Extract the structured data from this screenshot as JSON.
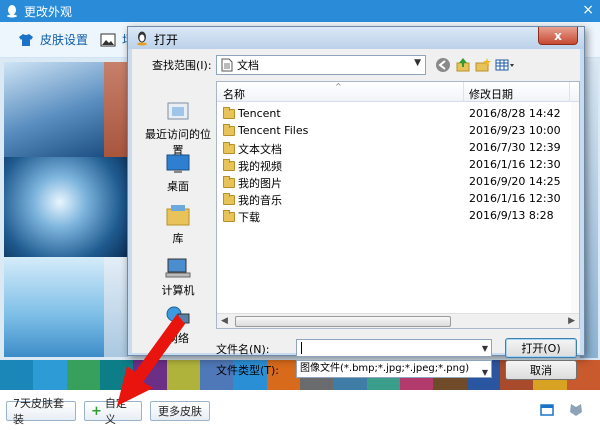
{
  "outer": {
    "title": "更改外观",
    "close": "×",
    "toolbar": {
      "skin_settings": "皮肤设置",
      "second_tab": "场"
    },
    "bottom": {
      "seven_day": "7天皮肤套装",
      "custom": "自定义",
      "more_skins": "更多皮肤"
    },
    "swatch_colors": [
      "#1b86b8",
      "#2d9bd5",
      "#37a05d",
      "#0d7d88",
      "#6b2f86",
      "#b0b33b",
      "#4f78b8",
      "#2b8fd6",
      "#d86a1b",
      "#6a6b6c",
      "#3f7ca6",
      "#3a9e8a",
      "#b33a6d",
      "#6f4b2a",
      "#2a55a0",
      "#a84a2c",
      "#d8a323",
      "#c95a2e"
    ]
  },
  "dialog": {
    "title": "打开",
    "close": "x",
    "look_in_label": "查找范围(I):",
    "look_in_value": "文档",
    "places": [
      {
        "label": "最近访问的位置",
        "icon": "recent-places-icon"
      },
      {
        "label": "桌面",
        "icon": "desktop-icon"
      },
      {
        "label": "库",
        "icon": "libraries-icon"
      },
      {
        "label": "计算机",
        "icon": "computer-icon"
      },
      {
        "label": "网络",
        "icon": "network-icon"
      }
    ],
    "columns": {
      "name": "名称",
      "date": "修改日期"
    },
    "files": [
      {
        "name": "Tencent",
        "date": "2016/8/28 14:42"
      },
      {
        "name": "Tencent Files",
        "date": "2016/9/23 10:00"
      },
      {
        "name": "文本文档",
        "date": "2016/7/30 12:39"
      },
      {
        "name": "我的视频",
        "date": "2016/1/16 12:30"
      },
      {
        "name": "我的图片",
        "date": "2016/9/20 14:25"
      },
      {
        "name": "我的音乐",
        "date": "2016/1/16 12:30"
      },
      {
        "name": "下载",
        "date": "2016/9/13 8:28"
      }
    ],
    "filename_label": "文件名(N):",
    "filename_value": "",
    "filetype_label": "文件类型(T):",
    "filetype_value": "图像文件(*.bmp;*.jpg;*.jpeg;*.png)",
    "open_button": "打开(O)",
    "cancel_button": "取消"
  }
}
